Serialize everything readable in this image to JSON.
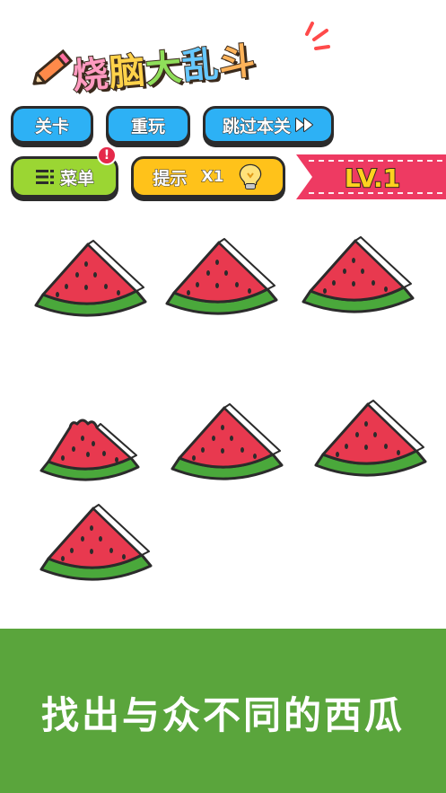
{
  "title": {
    "chars": [
      "烧",
      "脑",
      "大",
      "乱",
      "斗"
    ]
  },
  "toolbar": {
    "level_label": "关卡",
    "replay_label": "重玩",
    "skip_label": "跳过本关",
    "menu_label": "菜单",
    "menu_badge": "!",
    "hint_label": "提示",
    "hint_count": "X1"
  },
  "level": {
    "label": "LV.1"
  },
  "puzzle": {
    "items": [
      {
        "id": "melon-1",
        "bitten": false
      },
      {
        "id": "melon-2",
        "bitten": false
      },
      {
        "id": "melon-3",
        "bitten": false
      },
      {
        "id": "melon-4",
        "bitten": true
      },
      {
        "id": "melon-5",
        "bitten": false
      },
      {
        "id": "melon-6",
        "bitten": false
      },
      {
        "id": "melon-7",
        "bitten": false
      }
    ]
  },
  "banner": {
    "text": "找出与众不同的西瓜"
  },
  "colors": {
    "button_blue": "#2db1f5",
    "button_green": "#9bd633",
    "button_yellow": "#ffc21a",
    "ribbon_pink": "#ee3a62",
    "banner_green": "#5aa53c",
    "melon_red": "#e8394f",
    "melon_rind": "#4aa83b"
  },
  "icons": {
    "skip": "fast-forward-icon",
    "menu": "menu-list-icon",
    "hint": "light-bulb-icon",
    "title_deco": "pencil-icon"
  }
}
